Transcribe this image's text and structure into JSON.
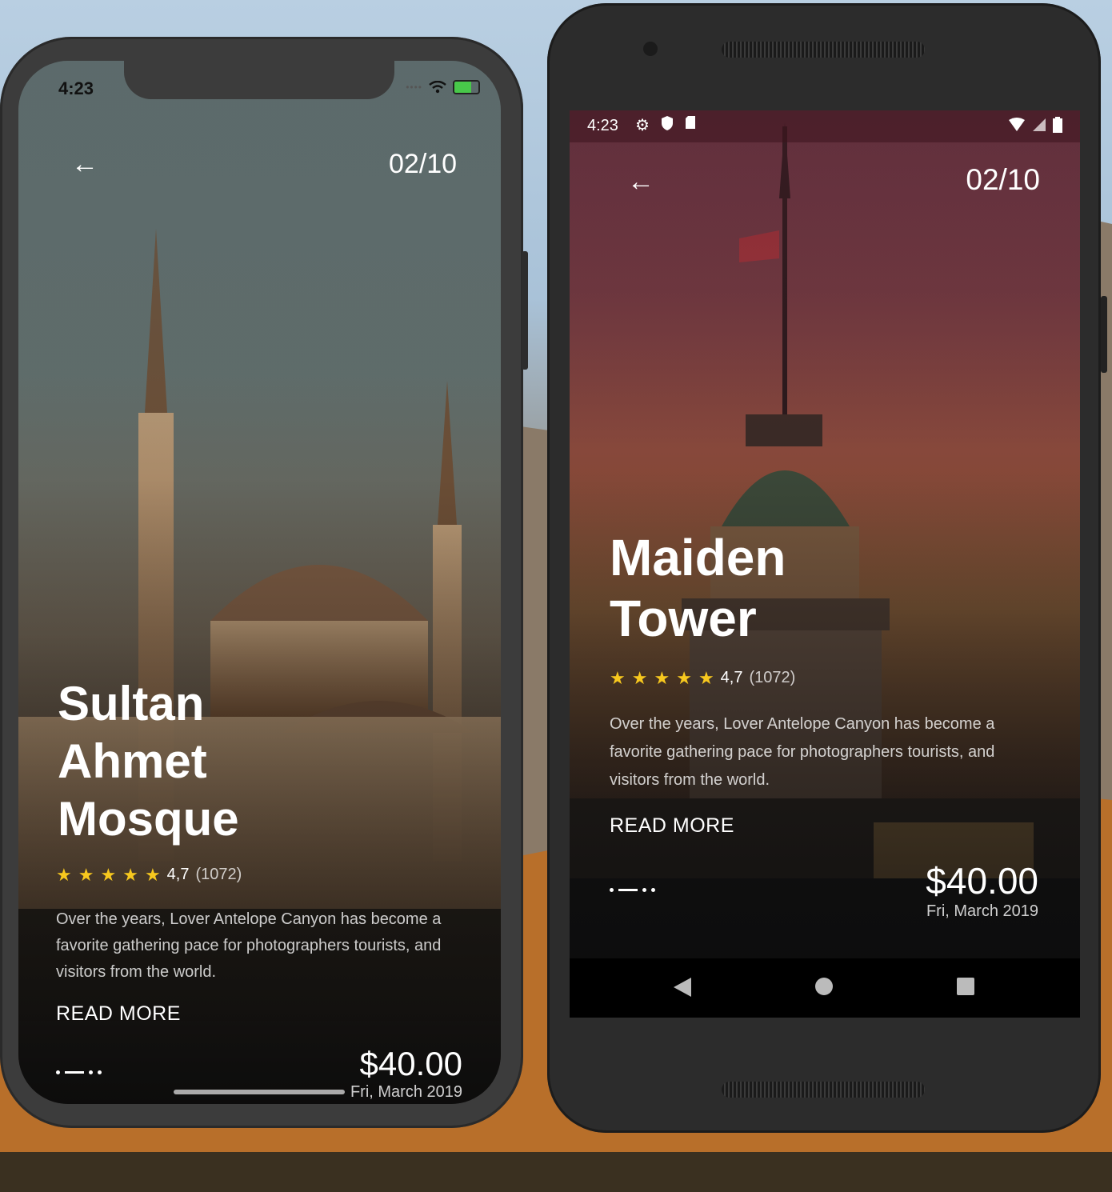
{
  "ios": {
    "time": "4:23",
    "counter": "02/10",
    "title_lines": [
      "Sultan",
      "Ahmet",
      "Mosque"
    ],
    "rating": "4,7",
    "rating_count": "(1072)",
    "description": "Over the years, Lover Antelope Canyon has become a favorite gathering pace for photographers tourists, and visitors from the world.",
    "read_more": "READ MORE",
    "price": "$40.00",
    "date": "Fri, March 2019"
  },
  "android": {
    "time": "4:23",
    "counter": "02/10",
    "title_lines": [
      "Maiden",
      "Tower"
    ],
    "rating": "4,7",
    "rating_count": "(1072)",
    "description": "Over the years, Lover Antelope Canyon has become a favorite gathering pace for photographers tourists, and visitors from the world.",
    "read_more": "READ MORE",
    "price": "$40.00",
    "date": "Fri, March 2019"
  },
  "icons": {
    "back": "back-arrow-icon",
    "star": "star-icon",
    "wifi": "wifi-icon",
    "battery": "battery-icon",
    "settings": "gear-icon",
    "shield": "shield-icon",
    "sdcard": "sd-card-icon",
    "signal": "signal-icon"
  },
  "colors": {
    "star": "#f7c81e",
    "text": "#ffffff"
  }
}
